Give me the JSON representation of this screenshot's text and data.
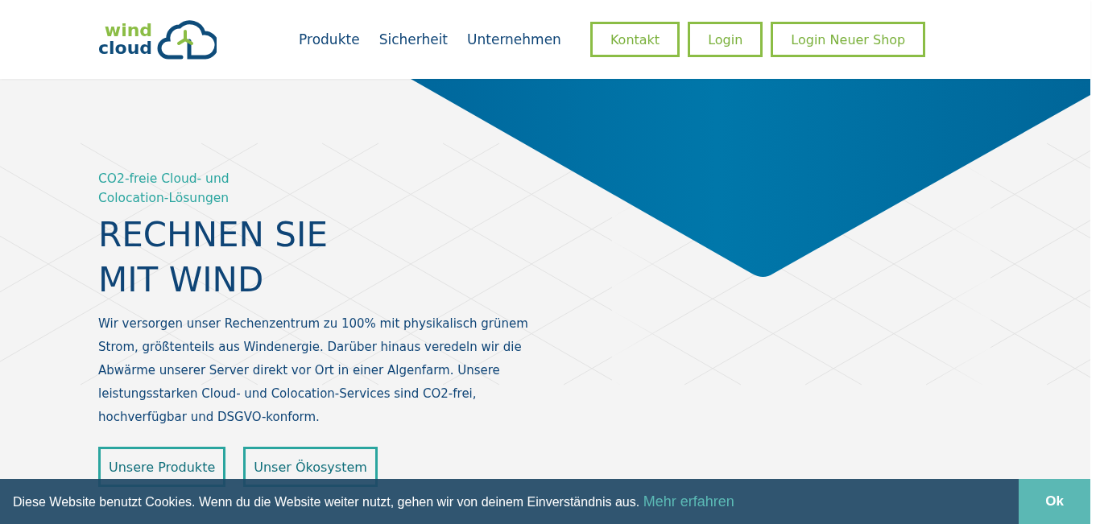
{
  "logo": {
    "top": "wind",
    "bottom": "cloud"
  },
  "nav": {
    "links": [
      "Produkte",
      "Sicherheit",
      "Unternehmen"
    ],
    "buttons": [
      "Kontakt",
      "Login",
      "Login Neuer Shop"
    ]
  },
  "hero": {
    "kicker": "CO2-freie Cloud- und Colocation-Lösungen",
    "title_lines": [
      "RECHNEN SIE",
      "MIT WIND"
    ],
    "text": "Wir versorgen unser Rechenzentrum zu 100% mit physikalisch grünem Strom, größtenteils aus Windenergie. Darüber hinaus veredeln wir die Abwärme unserer Server direkt vor Ort in einer Algenfarm. Unsere leistungsstarken Cloud- und Colocation-Services sind CO2-frei, hochverfügbar und DSGVO-konform.",
    "buttons": [
      "Unsere Produkte",
      "Unser Ökosystem"
    ]
  },
  "cookie_bar": {
    "text": "Diese Website benutzt Cookies. Wenn du die Website weiter nutzt, gehen wir von deinem Einverständnis aus.",
    "link": "Mehr erfahren",
    "button": "Ok"
  }
}
